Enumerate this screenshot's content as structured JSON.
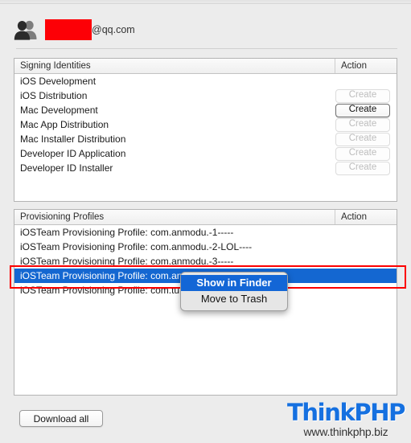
{
  "account": {
    "icon": "people-icon",
    "redacted_name": "",
    "domain": "@qq.com"
  },
  "signing_identities": {
    "header": {
      "name_column": "Signing Identities",
      "action_column": "Action"
    },
    "rows": [
      {
        "name": "iOS Development",
        "action": null,
        "enabled": false
      },
      {
        "name": "iOS Distribution",
        "action": "Create",
        "enabled": false
      },
      {
        "name": "Mac Development",
        "action": "Create",
        "enabled": true
      },
      {
        "name": "Mac App Distribution",
        "action": "Create",
        "enabled": false
      },
      {
        "name": "Mac Installer Distribution",
        "action": "Create",
        "enabled": false
      },
      {
        "name": "Developer ID Application",
        "action": "Create",
        "enabled": false
      },
      {
        "name": "Developer ID Installer",
        "action": "Create",
        "enabled": false
      }
    ]
  },
  "provisioning_profiles": {
    "header": {
      "name_column": "Provisioning Profiles",
      "action_column": "Action"
    },
    "rows": [
      {
        "name": "iOSTeam Provisioning Profile: com.anmodu.-1-----",
        "selected": false
      },
      {
        "name": "iOSTeam Provisioning Profile: com.anmodu.-2-LOL----",
        "selected": false
      },
      {
        "name": "iOSTeam Provisioning Profile: com.anmodu.-3-----",
        "selected": false
      },
      {
        "name": "iOSTeam Provisioning Profile: com.an",
        "selected": true
      },
      {
        "name": "iOSTeam Provisioning Profile: com.tur",
        "selected": false
      }
    ]
  },
  "context_menu": {
    "items": [
      {
        "label": "Show in Finder",
        "highlighted": true
      },
      {
        "label": "Move to Trash",
        "highlighted": false
      }
    ]
  },
  "footer": {
    "download_all_label": "Download all"
  },
  "watermark": {
    "title": "ThinkPHP",
    "url": "www.thinkphp.biz"
  },
  "colors": {
    "selection_blue": "#1467d1",
    "annotation_red": "#fc0000",
    "redaction_red": "#fd0006",
    "watermark_blue": "#1570e0",
    "window_bg": "#ececec"
  }
}
